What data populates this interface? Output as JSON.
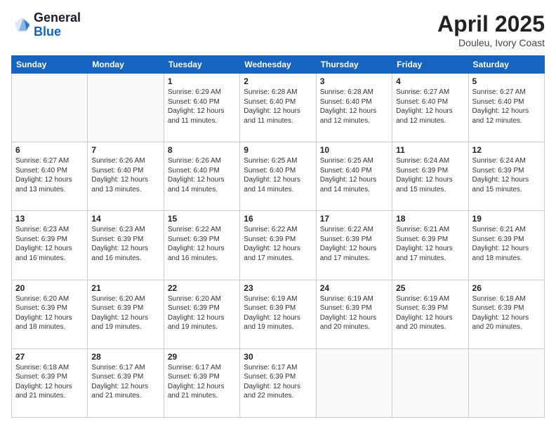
{
  "logo": {
    "line1": "General",
    "line2": "Blue"
  },
  "title": "April 2025",
  "subtitle": "Douleu, Ivory Coast",
  "days_of_week": [
    "Sunday",
    "Monday",
    "Tuesday",
    "Wednesday",
    "Thursday",
    "Friday",
    "Saturday"
  ],
  "weeks": [
    [
      {
        "day": "",
        "info": ""
      },
      {
        "day": "",
        "info": ""
      },
      {
        "day": "1",
        "info": "Sunrise: 6:29 AM\nSunset: 6:40 PM\nDaylight: 12 hours and 11 minutes."
      },
      {
        "day": "2",
        "info": "Sunrise: 6:28 AM\nSunset: 6:40 PM\nDaylight: 12 hours and 11 minutes."
      },
      {
        "day": "3",
        "info": "Sunrise: 6:28 AM\nSunset: 6:40 PM\nDaylight: 12 hours and 12 minutes."
      },
      {
        "day": "4",
        "info": "Sunrise: 6:27 AM\nSunset: 6:40 PM\nDaylight: 12 hours and 12 minutes."
      },
      {
        "day": "5",
        "info": "Sunrise: 6:27 AM\nSunset: 6:40 PM\nDaylight: 12 hours and 12 minutes."
      }
    ],
    [
      {
        "day": "6",
        "info": "Sunrise: 6:27 AM\nSunset: 6:40 PM\nDaylight: 12 hours and 13 minutes."
      },
      {
        "day": "7",
        "info": "Sunrise: 6:26 AM\nSunset: 6:40 PM\nDaylight: 12 hours and 13 minutes."
      },
      {
        "day": "8",
        "info": "Sunrise: 6:26 AM\nSunset: 6:40 PM\nDaylight: 12 hours and 14 minutes."
      },
      {
        "day": "9",
        "info": "Sunrise: 6:25 AM\nSunset: 6:40 PM\nDaylight: 12 hours and 14 minutes."
      },
      {
        "day": "10",
        "info": "Sunrise: 6:25 AM\nSunset: 6:40 PM\nDaylight: 12 hours and 14 minutes."
      },
      {
        "day": "11",
        "info": "Sunrise: 6:24 AM\nSunset: 6:39 PM\nDaylight: 12 hours and 15 minutes."
      },
      {
        "day": "12",
        "info": "Sunrise: 6:24 AM\nSunset: 6:39 PM\nDaylight: 12 hours and 15 minutes."
      }
    ],
    [
      {
        "day": "13",
        "info": "Sunrise: 6:23 AM\nSunset: 6:39 PM\nDaylight: 12 hours and 16 minutes."
      },
      {
        "day": "14",
        "info": "Sunrise: 6:23 AM\nSunset: 6:39 PM\nDaylight: 12 hours and 16 minutes."
      },
      {
        "day": "15",
        "info": "Sunrise: 6:22 AM\nSunset: 6:39 PM\nDaylight: 12 hours and 16 minutes."
      },
      {
        "day": "16",
        "info": "Sunrise: 6:22 AM\nSunset: 6:39 PM\nDaylight: 12 hours and 17 minutes."
      },
      {
        "day": "17",
        "info": "Sunrise: 6:22 AM\nSunset: 6:39 PM\nDaylight: 12 hours and 17 minutes."
      },
      {
        "day": "18",
        "info": "Sunrise: 6:21 AM\nSunset: 6:39 PM\nDaylight: 12 hours and 17 minutes."
      },
      {
        "day": "19",
        "info": "Sunrise: 6:21 AM\nSunset: 6:39 PM\nDaylight: 12 hours and 18 minutes."
      }
    ],
    [
      {
        "day": "20",
        "info": "Sunrise: 6:20 AM\nSunset: 6:39 PM\nDaylight: 12 hours and 18 minutes."
      },
      {
        "day": "21",
        "info": "Sunrise: 6:20 AM\nSunset: 6:39 PM\nDaylight: 12 hours and 19 minutes."
      },
      {
        "day": "22",
        "info": "Sunrise: 6:20 AM\nSunset: 6:39 PM\nDaylight: 12 hours and 19 minutes."
      },
      {
        "day": "23",
        "info": "Sunrise: 6:19 AM\nSunset: 6:39 PM\nDaylight: 12 hours and 19 minutes."
      },
      {
        "day": "24",
        "info": "Sunrise: 6:19 AM\nSunset: 6:39 PM\nDaylight: 12 hours and 20 minutes."
      },
      {
        "day": "25",
        "info": "Sunrise: 6:19 AM\nSunset: 6:39 PM\nDaylight: 12 hours and 20 minutes."
      },
      {
        "day": "26",
        "info": "Sunrise: 6:18 AM\nSunset: 6:39 PM\nDaylight: 12 hours and 20 minutes."
      }
    ],
    [
      {
        "day": "27",
        "info": "Sunrise: 6:18 AM\nSunset: 6:39 PM\nDaylight: 12 hours and 21 minutes."
      },
      {
        "day": "28",
        "info": "Sunrise: 6:17 AM\nSunset: 6:39 PM\nDaylight: 12 hours and 21 minutes."
      },
      {
        "day": "29",
        "info": "Sunrise: 6:17 AM\nSunset: 6:39 PM\nDaylight: 12 hours and 21 minutes."
      },
      {
        "day": "30",
        "info": "Sunrise: 6:17 AM\nSunset: 6:39 PM\nDaylight: 12 hours and 22 minutes."
      },
      {
        "day": "",
        "info": ""
      },
      {
        "day": "",
        "info": ""
      },
      {
        "day": "",
        "info": ""
      }
    ]
  ]
}
